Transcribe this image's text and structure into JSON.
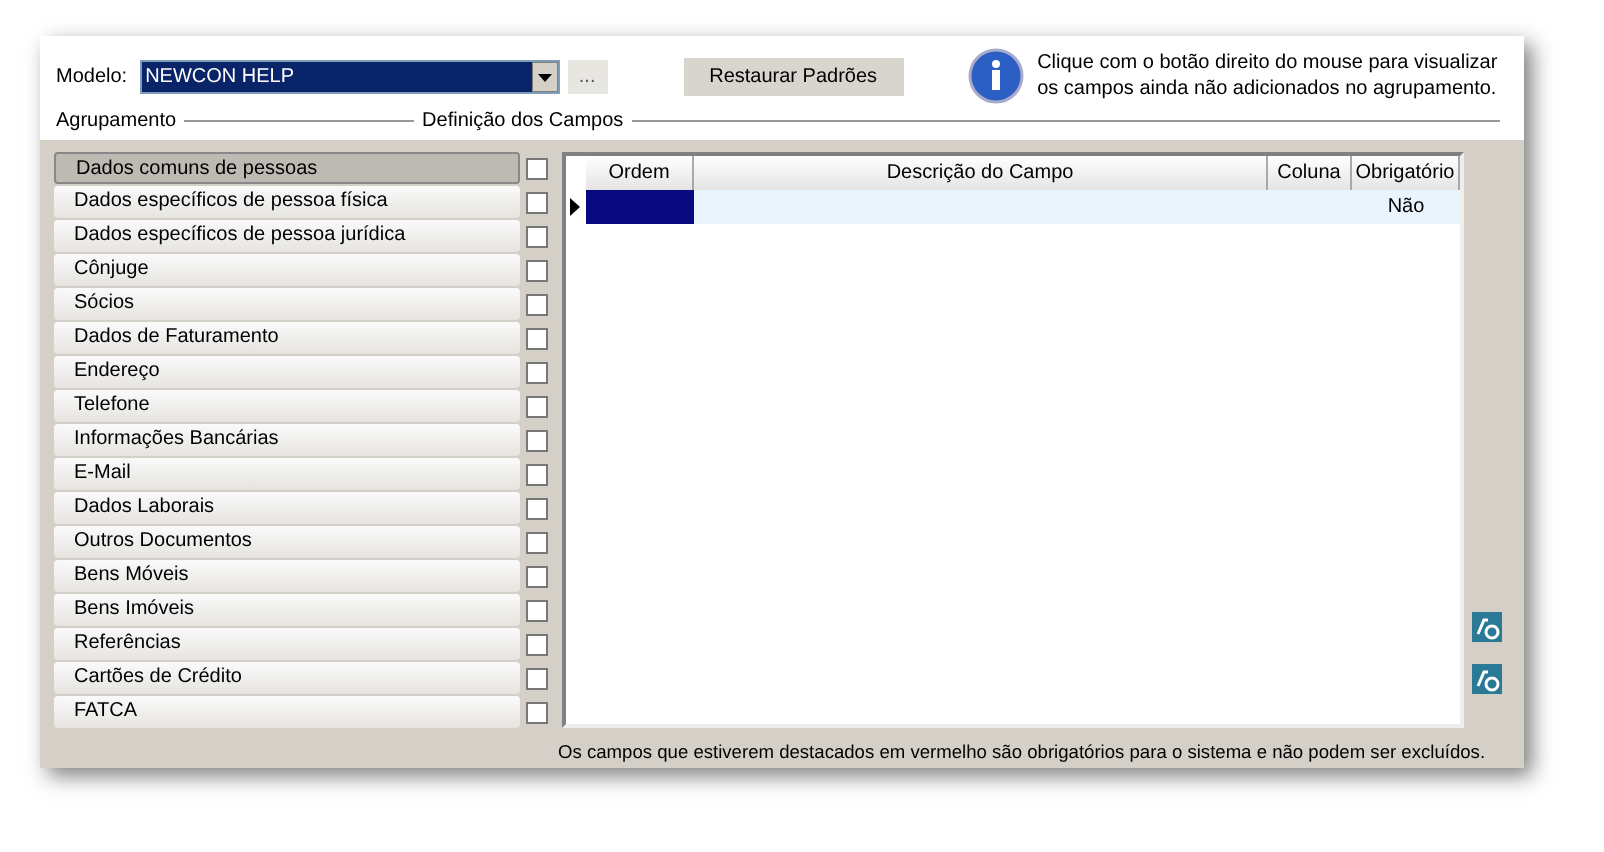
{
  "model": {
    "label": "Modelo:",
    "value": "NEWCON HELP",
    "more_button": "...",
    "restore_button": "Restaurar Padrões"
  },
  "info": "Clique com o botão direito do mouse para visualizar os campos ainda não adicionados no agrupamento.",
  "sections": {
    "grouping": "Agrupamento",
    "fields": "Definição dos Campos"
  },
  "groups": [
    {
      "label": "Dados comuns de pessoas",
      "selected": true,
      "checked": false
    },
    {
      "label": "Dados específicos de pessoa física",
      "selected": false,
      "checked": false
    },
    {
      "label": "Dados específicos de pessoa jurídica",
      "selected": false,
      "checked": false
    },
    {
      "label": "Cônjuge",
      "selected": false,
      "checked": false
    },
    {
      "label": "Sócios",
      "selected": false,
      "checked": false
    },
    {
      "label": "Dados de Faturamento",
      "selected": false,
      "checked": false
    },
    {
      "label": "Endereço",
      "selected": false,
      "checked": false
    },
    {
      "label": "Telefone",
      "selected": false,
      "checked": false
    },
    {
      "label": "Informações Bancárias",
      "selected": false,
      "checked": false
    },
    {
      "label": "E-Mail",
      "selected": false,
      "checked": false
    },
    {
      "label": "Dados Laborais",
      "selected": false,
      "checked": false
    },
    {
      "label": "Outros Documentos",
      "selected": false,
      "checked": false
    },
    {
      "label": "Bens Móveis",
      "selected": false,
      "checked": false
    },
    {
      "label": "Bens Imóveis",
      "selected": false,
      "checked": false
    },
    {
      "label": "Referências",
      "selected": false,
      "checked": false
    },
    {
      "label": "Cartões de Crédito",
      "selected": false,
      "checked": false
    },
    {
      "label": "FATCA",
      "selected": false,
      "checked": false
    }
  ],
  "table": {
    "columns": [
      "Ordem",
      "Descrição do Campo",
      "Coluna",
      "Obrigatório"
    ],
    "rows": [
      {
        "selected": true,
        "cells": [
          "",
          "",
          "",
          "Não"
        ]
      }
    ]
  },
  "footer": "Os campos que estiverem destacados em vermelho são obrigatórios para o sistema e não podem ser excluídos."
}
